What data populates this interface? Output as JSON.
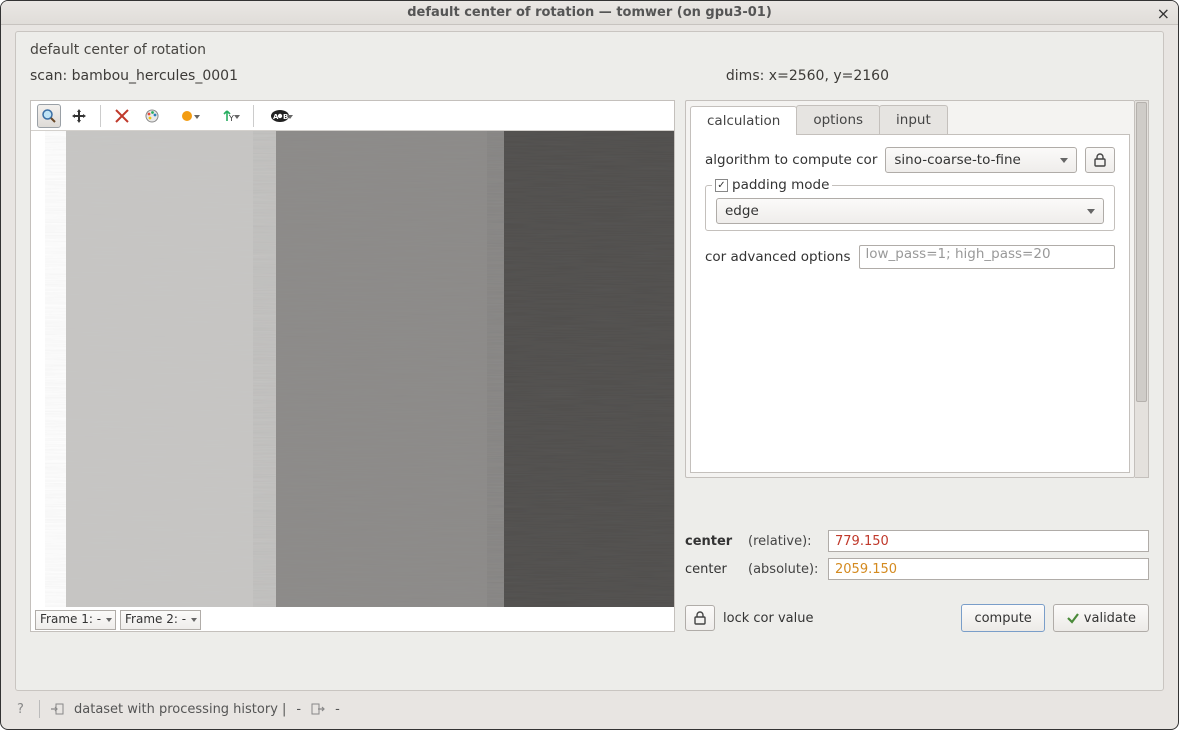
{
  "window": {
    "title": "default center of rotation — tomwer (on gpu3-01)"
  },
  "frame_label": "default center of rotation",
  "info": {
    "scan_label": "scan:",
    "scan_value": "bambou_hercules_0001",
    "dims_label": "dims:",
    "dims_value": "x=2560, y=2160"
  },
  "toolbar_icons": {
    "zoom": "zoom-icon",
    "pan": "pan-icon",
    "cross": "crosshair-icon",
    "palette": "palette-icon",
    "circle": "circle-icon",
    "yaxis": "y-axis-icon",
    "ab": "ab-compare-icon"
  },
  "frames": {
    "f1": "Frame 1: -",
    "f2": "Frame 2: -"
  },
  "tabs": {
    "calculation": "calculation",
    "options": "options",
    "input": "input"
  },
  "calc": {
    "algo_label": "algorithm to compute cor",
    "algo_value": "sino-coarse-to-fine",
    "padding_label": "padding mode",
    "padding_checked": true,
    "padding_value": "edge",
    "adv_label": "cor advanced options",
    "adv_placeholder": "low_pass=1; high_pass=20"
  },
  "center": {
    "label_bold": "center",
    "relative_label": "(relative):",
    "relative_value": "779.150",
    "label_plain": "center",
    "absolute_label": "(absolute):",
    "absolute_value": "2059.150"
  },
  "actions": {
    "lock_label": "lock cor value",
    "compute": "compute",
    "validate": "validate"
  },
  "status": {
    "text": "dataset with processing history |",
    "dash1": "-",
    "dash2": "-"
  }
}
